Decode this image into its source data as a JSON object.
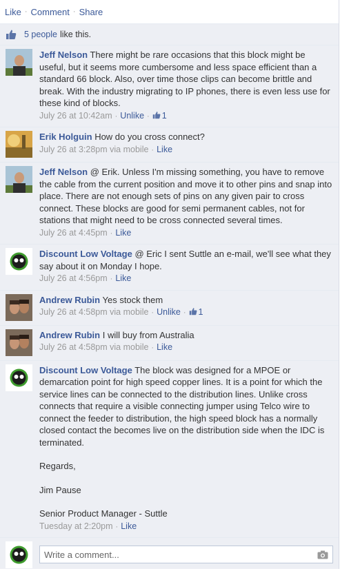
{
  "actions": {
    "like": "Like",
    "comment": "Comment",
    "share": "Share"
  },
  "likes": {
    "count": "5 people",
    "suffix": "like this."
  },
  "comments": [
    {
      "author": "Jeff Nelson",
      "text": "There might be rare occasions that this block might be useful, but it seems more cumbersome and less space efficient than a standard 66 block. Also, over time those clips can become brittle and break. With the industry migrating to IP phones, there is even less use for these kind of blocks.",
      "time": "July 26 at 10:42am",
      "unlike": "Unlike",
      "like_count": "1"
    },
    {
      "author": "Erik Holguin",
      "text": "How do you cross connect?",
      "time": "July 26 at 3:28pm via mobile",
      "like": "Like"
    },
    {
      "author": "Jeff Nelson",
      "text": "@ Erik. Unless I'm missing something, you have to remove the cable from the current position and move it to other pins and snap into place. There are not enough sets of pins on any given pair to cross connect. These blocks are good for semi permanent cables, not for stations that might need to be cross connected several times.",
      "time": "July 26 at 4:45pm",
      "like": "Like"
    },
    {
      "author": "Discount Low Voltage",
      "text": "@ Eric I sent Suttle an e-mail, we'll see what they say about it on Monday I hope.",
      "time": "July 26 at 4:56pm",
      "like": "Like"
    },
    {
      "author": "Andrew Rubin",
      "text": "Yes stock them",
      "time": "July 26 at 4:58pm via mobile",
      "unlike": "Unlike",
      "like_count": "1"
    },
    {
      "author": "Andrew Rubin",
      "text": "I will buy from Australia",
      "time": "July 26 at 4:58pm via mobile",
      "like": "Like"
    },
    {
      "author": "Discount Low Voltage",
      "text": "The block was designed for a MPOE or demarcation point for high speed copper lines. It is a point for which the service lines can be connected to the distribution lines. Unlike cross connects that require a visible connecting jumper using Telco wire to connect the feeder to distribution, the high speed block has a normally closed contact the becomes live on the distribution side when the IDC is terminated.",
      "regards": "Regards,",
      "name": "Jim Pause",
      "title": "Senior Product Manager - Suttle",
      "time": "Tuesday at 2:20pm",
      "like": "Like"
    }
  ],
  "write": {
    "placeholder": "Write a comment..."
  },
  "colors": {
    "link": "#3b5998",
    "meta": "#999999",
    "bg": "#edeff4"
  },
  "icons": {
    "like": "thumbs-up-icon",
    "camera": "camera-icon"
  }
}
